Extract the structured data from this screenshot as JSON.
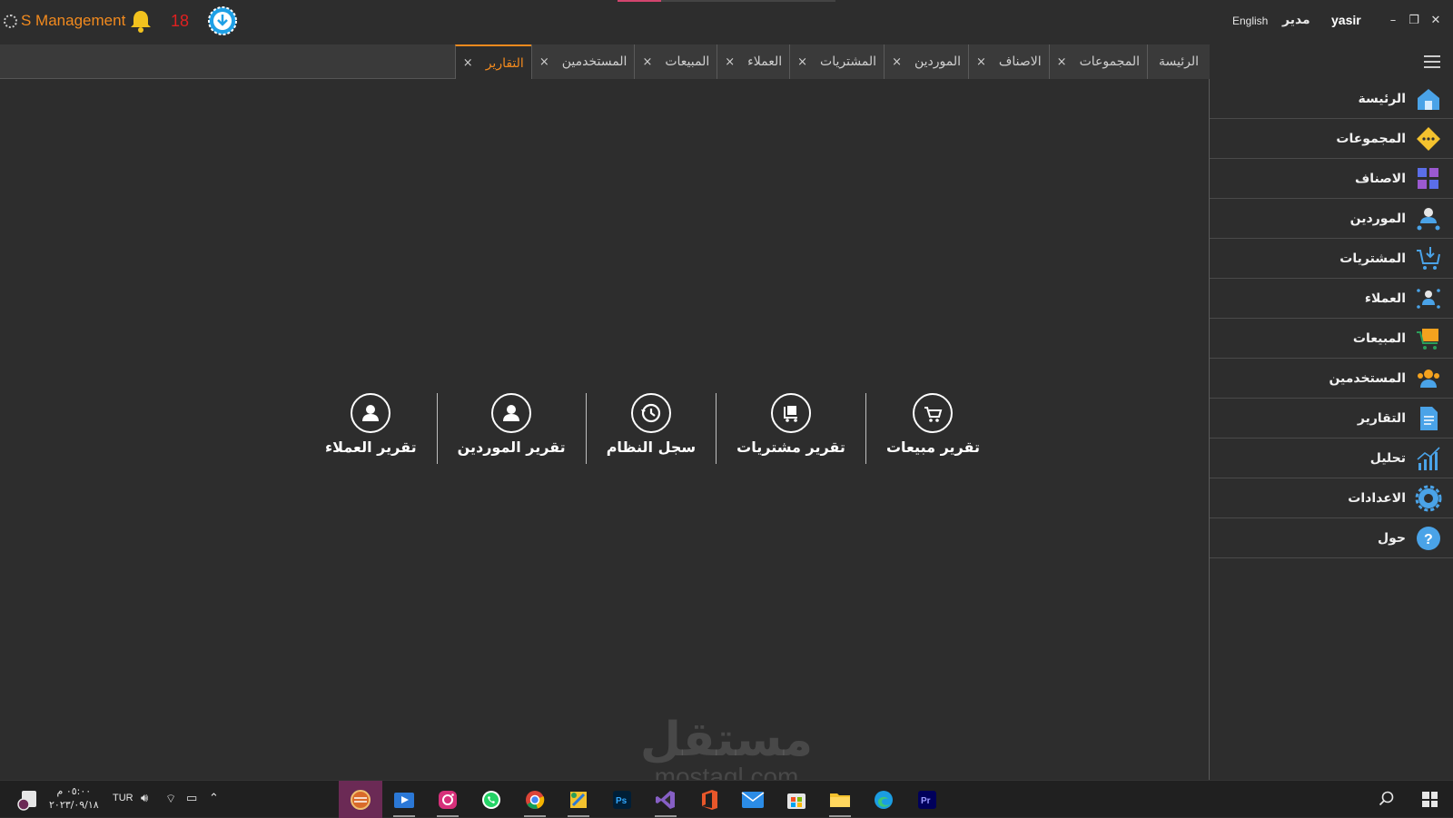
{
  "app": {
    "brand": "S Management",
    "notification_count": "18"
  },
  "header": {
    "language": "English",
    "role": "مدير",
    "username": "yasir",
    "minimize": "–",
    "restore": "❐",
    "close": "✕"
  },
  "tabs": [
    {
      "label": "الرئيسة",
      "closable": false
    },
    {
      "label": "المجموعات",
      "closable": true
    },
    {
      "label": "الاصناف",
      "closable": true
    },
    {
      "label": "الموردين",
      "closable": true
    },
    {
      "label": "المشتريات",
      "closable": true
    },
    {
      "label": "العملاء",
      "closable": true
    },
    {
      "label": "المبيعات",
      "closable": true
    },
    {
      "label": "المستخدمين",
      "closable": true
    },
    {
      "label": "التقارير",
      "closable": true,
      "active": true
    }
  ],
  "reports": [
    {
      "label": "تقرير مبيعات",
      "icon": "cart-icon"
    },
    {
      "label": "تقرير مشتريات",
      "icon": "purchase-cart-icon"
    },
    {
      "label": "سجل النظام",
      "icon": "history-icon"
    },
    {
      "label": "تقرير الموردين",
      "icon": "user-icon"
    },
    {
      "label": "تقرير العملاء",
      "icon": "user-icon"
    }
  ],
  "sidebar": {
    "items": [
      {
        "label": "الرئيسة",
        "icon": "home-icon"
      },
      {
        "label": "المجموعات",
        "icon": "groups-icon"
      },
      {
        "label": "الاصناف",
        "icon": "categories-icon"
      },
      {
        "label": "الموردين",
        "icon": "suppliers-icon"
      },
      {
        "label": "المشتريات",
        "icon": "purchases-icon"
      },
      {
        "label": "العملاء",
        "icon": "customers-icon"
      },
      {
        "label": "المبيعات",
        "icon": "sales-icon"
      },
      {
        "label": "المستخدمين",
        "icon": "users-icon"
      },
      {
        "label": "التقارير",
        "icon": "reports-icon"
      },
      {
        "label": "تحليل",
        "icon": "analysis-icon"
      },
      {
        "label": "الاعدادات",
        "icon": "settings-icon"
      },
      {
        "label": "حول",
        "icon": "help-icon"
      }
    ]
  },
  "watermark": {
    "arabic": "مستقل",
    "latin": "mostaql.com"
  },
  "taskbar": {
    "time": "٠٥:٠٠ م",
    "date": "٢٠٢٣/٠٩/١٨",
    "language": "TUR"
  },
  "colors": {
    "accent": "#f28a1e",
    "background": "#2d2d2d",
    "notification": "#e02020"
  }
}
